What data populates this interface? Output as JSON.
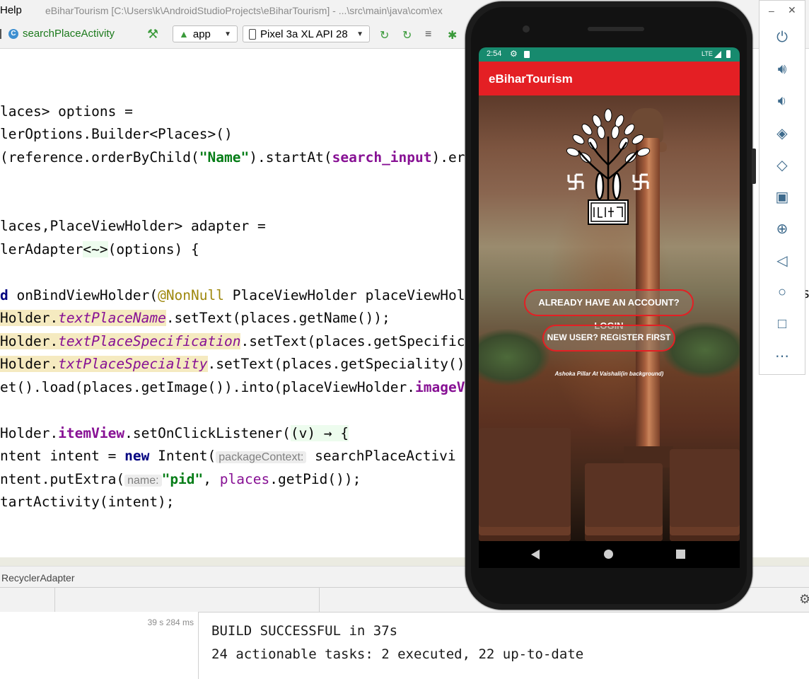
{
  "ide": {
    "menu_help": "Help",
    "window_title": "eBiharTourism [C:\\Users\\k\\AndroidStudioProjects\\eBiharTourism] - ...\\src\\main\\java\\com\\ex",
    "current_file": "searchPlaceActivity",
    "run_config": "app",
    "device": "Pixel 3a XL API 28",
    "code": {
      "l1_a": "laces> options =",
      "l2_a": "lerOptions.Builder<Places>()",
      "l3_a": "(reference.orderByChild(",
      "l3_str": "\"Name\"",
      "l3_b": ").startAt(",
      "l3_var": "search_input",
      "l3_c": ").er",
      "l4_a": "laces,PlaceViewHolder> adapter =",
      "l5_a": "lerAdapter",
      "l5_diamond": "<~>",
      "l5_b": "(options) {",
      "l6_kw": "d",
      "l6_a": " onBindViewHolder(",
      "l6_ann": "@NonNull",
      "l6_b": " PlaceViewHolder placeViewHol",
      "l7_a": "Holder.",
      "l7_fld": "textPlaceName",
      "l7_b": ".setText(places.getName());",
      "l8_a": "Holder.",
      "l8_fld": "textPlaceSpecification",
      "l8_b": ".setText(places.getSpecific",
      "l9_a": "Holder.",
      "l9_fld": "txtPlaceSpeciality",
      "l9_b": ".setText(places.getSpeciality()",
      "l10_a": "et().load(places.getImage()).into(placeViewHolder.",
      "l10_fld": "imageV",
      "l11_a": "Holder.",
      "l11_fld": "itemView",
      "l11_b": ".setOnClickListener(",
      "l11_lambda": "(v) → {",
      "l12_a": "ntent intent = ",
      "l12_kw": "new",
      "l12_b": " Intent(",
      "l12_hint": "packageContext:",
      "l12_c": " searchPlaceActivi",
      "l13_a": "ntent.putExtra(",
      "l13_hint": "name:",
      "l13_str": "\"pid\"",
      "l13_b": ", ",
      "l13_var": "places",
      "l13_c": ".getPid());",
      "l14_a": "tartActivity(intent);",
      "cut_s": "s"
    },
    "breadcrumb": "RecyclerAdapter",
    "build_time": "39 s 284 ms",
    "build_output": [
      "BUILD SUCCESSFUL in 37s",
      "24 actionable tasks: 2 executed, 22 up-to-date"
    ]
  },
  "phone": {
    "status": {
      "time": "2:54",
      "network": "LTE"
    },
    "app_title": "eBiharTourism",
    "login_button": "ALREADY HAVE AN ACCOUNT? LOGIN",
    "register_button": "NEW USER? REGISTER FIRST",
    "caption": "Ashoka Pillar At Vaishali(in background)",
    "accent_color": "#e41f24",
    "status_color": "#178a6e"
  },
  "emulator_panel": {
    "buttons": [
      "power-icon",
      "volume-up-icon",
      "volume-down-icon",
      "rotate-left-icon",
      "rotate-right-icon",
      "camera-icon",
      "zoom-icon",
      "back-icon",
      "home-icon",
      "overview-icon",
      "more-icon"
    ]
  }
}
